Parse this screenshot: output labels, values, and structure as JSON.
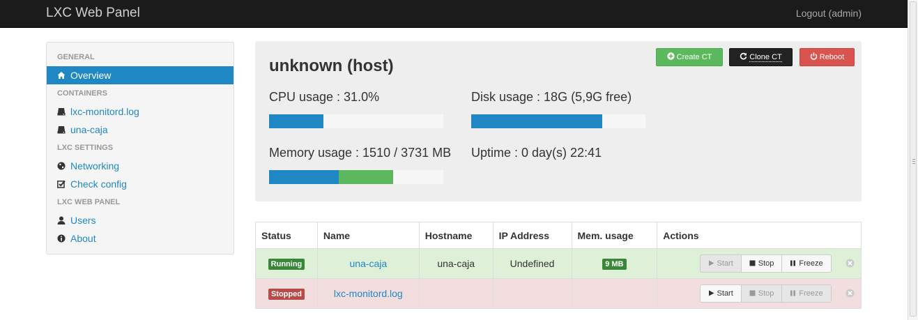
{
  "navbar": {
    "brand": "LXC Web Panel",
    "logout": "Logout (admin)"
  },
  "sidebar": {
    "sections": [
      {
        "header": "GENERAL",
        "items": [
          {
            "label": "Overview",
            "icon": "home-icon",
            "active": true
          }
        ]
      },
      {
        "header": "CONTAINERS",
        "items": [
          {
            "label": "lxc-monitord.log",
            "icon": "server-icon"
          },
          {
            "label": "una-caja",
            "icon": "server-icon"
          }
        ]
      },
      {
        "header": "LXC SETTINGS",
        "items": [
          {
            "label": "Networking",
            "icon": "globe-icon"
          },
          {
            "label": "Check config",
            "icon": "check-square-icon"
          }
        ]
      },
      {
        "header": "LXC WEB PANEL",
        "items": [
          {
            "label": "Users",
            "icon": "user-icon"
          },
          {
            "label": "About",
            "icon": "info-icon"
          }
        ]
      }
    ]
  },
  "host": {
    "title": "unknown (host)",
    "cpu": {
      "label": "CPU usage : 31.0%",
      "percent": 31.0,
      "color": "#1f87c4"
    },
    "disk": {
      "label": "Disk usage : 18G (5,9G free)",
      "percent": 75,
      "color": "#1f87c4"
    },
    "memory": {
      "label": "Memory usage : 1510 / 3731 MB",
      "segments": [
        {
          "percent": 40,
          "color": "#1f87c4"
        },
        {
          "percent": 31,
          "color": "#5cb85c"
        }
      ]
    },
    "uptime": "Uptime : 0 day(s) 22:41",
    "buttons": {
      "create": "Create CT",
      "clone": "Clone CT",
      "reboot": "Reboot"
    }
  },
  "table": {
    "headers": [
      "Status",
      "Name",
      "Hostname",
      "IP Address",
      "Mem. usage",
      "Actions"
    ],
    "rows": [
      {
        "status": "Running",
        "name": "una-caja",
        "hostname": "una-caja",
        "ip": "Undefined",
        "mem": "9 MB",
        "actions": {
          "start": "Start",
          "stop": "Stop",
          "freeze": "Freeze"
        }
      },
      {
        "status": "Stopped",
        "name": "lxc-monitord.log",
        "hostname": "",
        "ip": "",
        "mem": "",
        "actions": {
          "start": "Start",
          "stop": "Stop",
          "freeze": "Freeze"
        }
      }
    ]
  },
  "colors": {
    "primary": "#1f87c4",
    "success": "#5cb85c",
    "danger": "#d9534f",
    "navbar": "#1b1b1b"
  }
}
